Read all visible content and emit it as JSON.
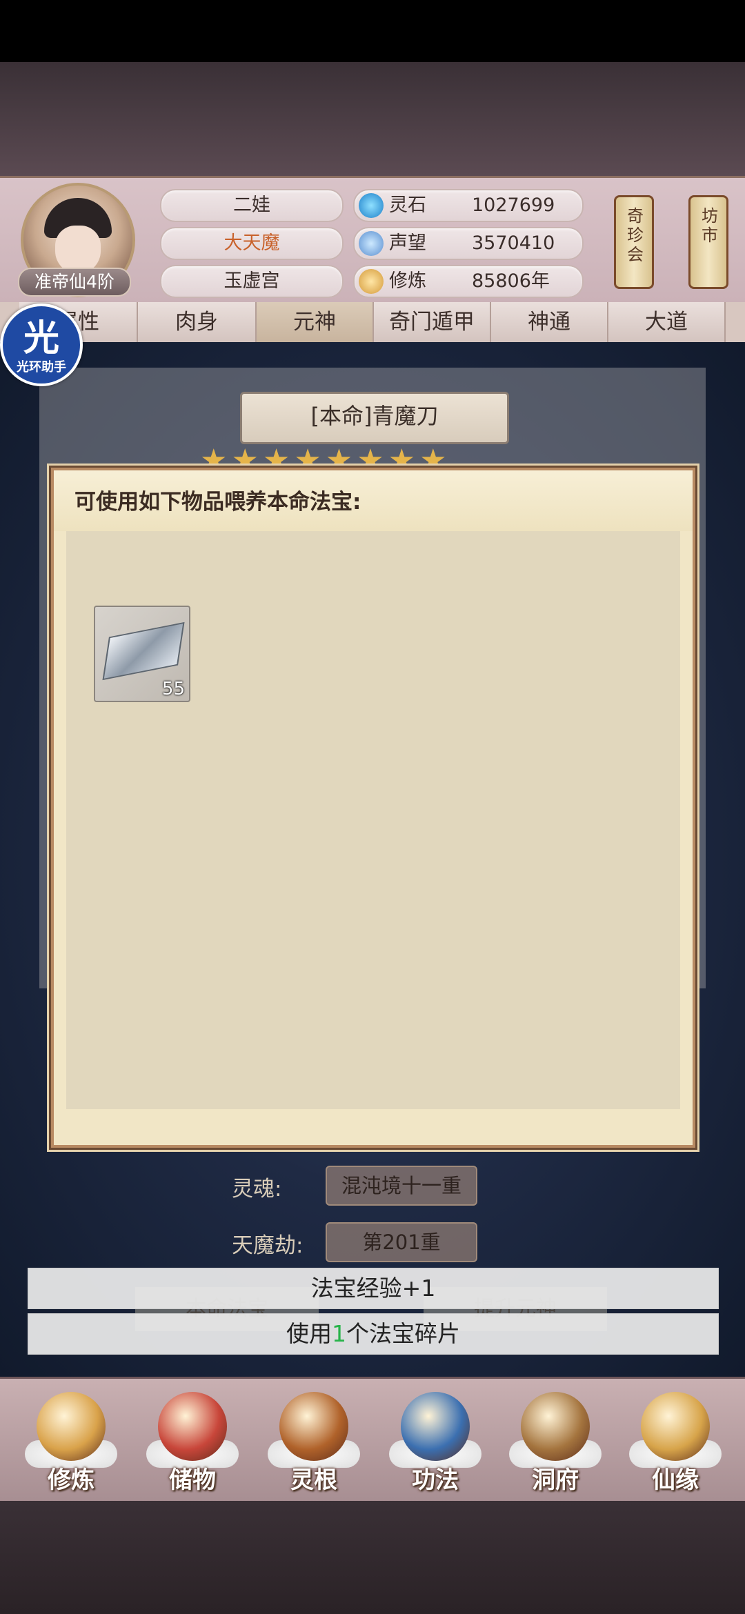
{
  "header": {
    "player_name": "二娃",
    "title": "大天魔",
    "sect": "玉虚宫",
    "rank": "准帝仙4阶",
    "resources": [
      {
        "label": "灵石",
        "value": "1027699",
        "icon": "spirit-stone-icon"
      },
      {
        "label": "声望",
        "value": "3570410",
        "icon": "reputation-icon"
      },
      {
        "label": "修炼",
        "value": "85806年",
        "icon": "cultivation-icon"
      }
    ],
    "shortcuts": [
      {
        "label": "奇珍会"
      },
      {
        "label": "坊市"
      }
    ]
  },
  "tabs": [
    {
      "label": "属性"
    },
    {
      "label": "肉身"
    },
    {
      "label": "元神"
    },
    {
      "label": "奇门遁甲"
    },
    {
      "label": "神通"
    },
    {
      "label": "大道"
    }
  ],
  "assistant_badge": {
    "big": "光",
    "small": "光环助手"
  },
  "weapon": {
    "name": "[本命]青魔刀",
    "stars": "★★★★★★★★"
  },
  "modal": {
    "title": "可使用如下物品喂养本命法宝:",
    "items": [
      {
        "icon": "artifact-fragment-icon",
        "count": "55"
      }
    ]
  },
  "stats": [
    {
      "label": "灵魂:",
      "value": "混沌境十一重"
    },
    {
      "label": "天魔劫:",
      "value": "第201重"
    }
  ],
  "background_buttons": [
    {
      "label": "本命法宝"
    },
    {
      "label": "提升元神"
    }
  ],
  "toasts": {
    "exp": "法宝经验+1",
    "use_prefix": "使用",
    "use_count": "1",
    "use_suffix": "个法宝碎片"
  },
  "nav": [
    {
      "label": "修炼",
      "icon": "cultivate-icon",
      "color": "#d9a24a"
    },
    {
      "label": "储物",
      "icon": "storage-bag-icon",
      "color": "#c8463a"
    },
    {
      "label": "灵根",
      "icon": "spirit-root-icon",
      "color": "#b0622a"
    },
    {
      "label": "功法",
      "icon": "technique-book-icon",
      "color": "#3b6fb0"
    },
    {
      "label": "洞府",
      "icon": "cave-mansion-icon",
      "color": "#a4743e"
    },
    {
      "label": "仙缘",
      "icon": "immortal-fate-icon",
      "color": "#d7a44a"
    }
  ]
}
